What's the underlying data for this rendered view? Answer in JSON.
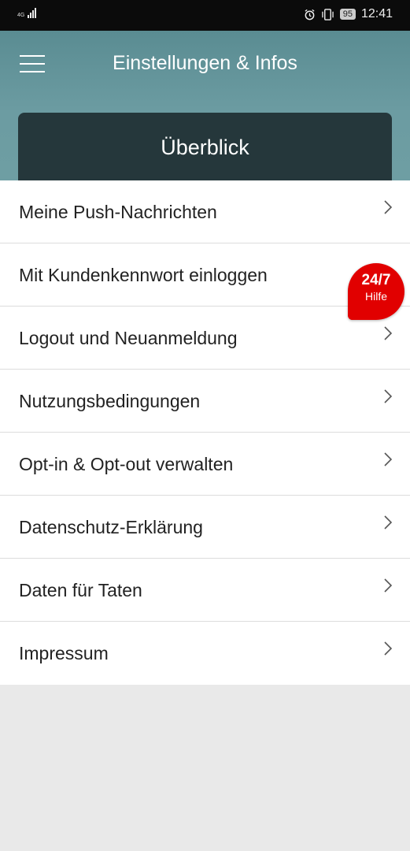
{
  "status_bar": {
    "network": "4G",
    "time": "12:41",
    "battery": "95",
    "icons": [
      "alarm-icon",
      "vibrate-icon"
    ]
  },
  "header": {
    "title": "Einstellungen & Infos",
    "menu_icon": "hamburger-menu-icon",
    "overview_label": "Überblick"
  },
  "menu": {
    "items": [
      {
        "label": "Meine Push-Nachrichten"
      },
      {
        "label": "Mit Kundenkennwort einloggen"
      },
      {
        "label": "Logout und Neuanmeldung"
      },
      {
        "label": "Nutzungsbedingungen"
      },
      {
        "label": "Opt-in & Opt-out verwalten"
      },
      {
        "label": "Datenschutz-Erklärung"
      },
      {
        "label": "Daten für Taten"
      },
      {
        "label": "Impressum"
      }
    ]
  },
  "help_bubble": {
    "title": "24/7",
    "subtitle": "Hilfe",
    "color": "#e10000"
  },
  "colors": {
    "header_bg": "#6c9ca2",
    "card_bg": "#25373b",
    "page_bg": "#e9e9e9"
  }
}
